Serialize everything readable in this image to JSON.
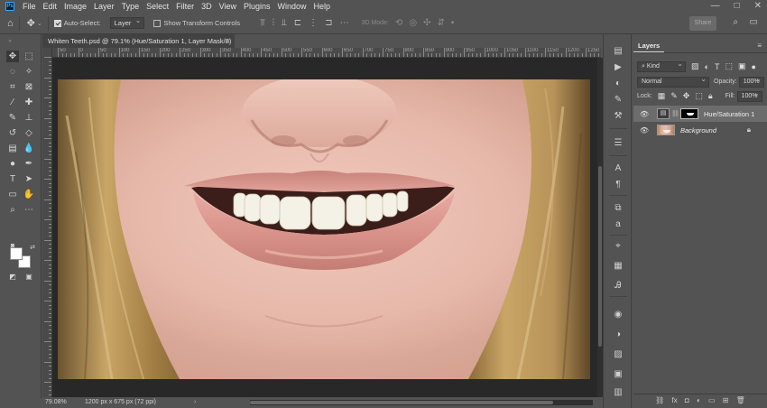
{
  "app": {
    "logo_text": "Ps"
  },
  "menu": {
    "items": [
      "File",
      "Edit",
      "Image",
      "Layer",
      "Type",
      "Select",
      "Filter",
      "3D",
      "View",
      "Plugins",
      "Window",
      "Help"
    ],
    "window_controls": [
      "—",
      "□",
      "✕"
    ]
  },
  "options_bar": {
    "auto_select_label": "Auto-Select:",
    "auto_select_checked": true,
    "auto_select_target": "Layer",
    "show_transform_label": "Show Transform Controls",
    "mode_3d_label": "3D Mode:",
    "share_label": "Share"
  },
  "document": {
    "tab_title": "Whiten Teeth.psd @ 79.1% (Hue/Saturation 1, Layer Mask/8)",
    "tab_close": "×"
  },
  "ruler": {
    "top_labels": [
      "50",
      "0",
      "50",
      "100",
      "150",
      "200",
      "250",
      "300",
      "350",
      "400",
      "450",
      "500",
      "550",
      "600",
      "650",
      "700",
      "750",
      "800",
      "850",
      "900",
      "950",
      "1000",
      "1050",
      "1100",
      "1150",
      "1200",
      "1250"
    ]
  },
  "status": {
    "zoom": "79.08%",
    "doc_size": "1200 px x 675 px (72 ppi)",
    "arrow": "›"
  },
  "layers_panel": {
    "tab_label": "Layers",
    "filter_kind": "Kind",
    "blend_mode": "Normal",
    "opacity_label": "Opacity:",
    "opacity_value": "100%",
    "lock_label": "Lock:",
    "fill_label": "Fill:",
    "fill_value": "100%",
    "layers": [
      {
        "name": "Hue/Saturation 1",
        "selected": true,
        "italic": false
      },
      {
        "name": "Background",
        "selected": false,
        "italic": true
      }
    ]
  },
  "colors": {
    "ui_bg": "#535353",
    "canvas_bg": "#282828",
    "selected_layer": "#6c6c6c",
    "ps_blue": "#31a8ff"
  }
}
